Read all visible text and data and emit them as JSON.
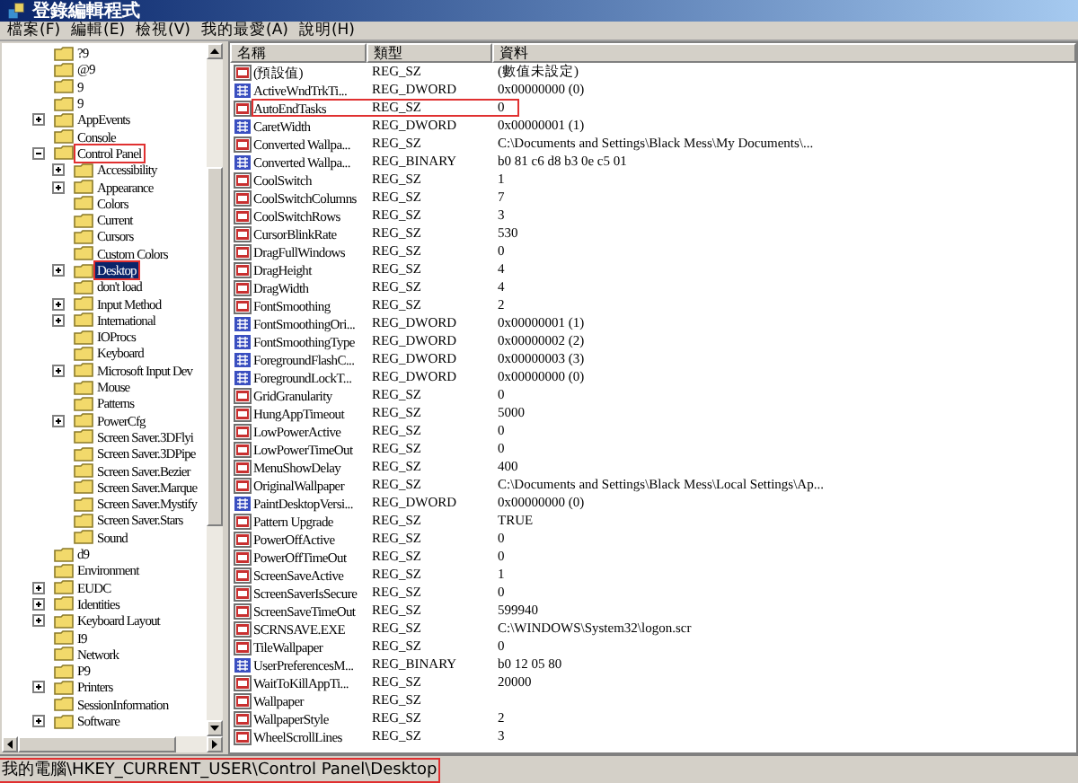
{
  "window": {
    "title": "登錄編輯程式"
  },
  "menu": [
    "檔案(F)",
    "編輯(E)",
    "檢視(V)",
    "我的最愛(A)",
    "說明(H)"
  ],
  "tree": [
    {
      "label": "?9",
      "kind": "leaf",
      "selected": false,
      "marked": false
    },
    {
      "label": "@9",
      "kind": "leaf",
      "selected": false,
      "marked": false
    },
    {
      "label": "9",
      "kind": "leaf",
      "selected": false,
      "marked": false
    },
    {
      "label": "9",
      "kind": "leaf",
      "selected": false,
      "marked": false
    },
    {
      "label": "AppEvents",
      "kind": "plus",
      "selected": false,
      "marked": false
    },
    {
      "label": "Console",
      "kind": "leaf",
      "selected": false,
      "marked": false
    },
    {
      "label": "Control Panel",
      "kind": "minus",
      "selected": false,
      "marked": true,
      "children": [
        {
          "label": "Accessibility",
          "kind": "plus",
          "selected": false,
          "marked": false
        },
        {
          "label": "Appearance",
          "kind": "plus",
          "selected": false,
          "marked": false
        },
        {
          "label": "Colors",
          "kind": "leaf",
          "selected": false,
          "marked": false
        },
        {
          "label": "Current",
          "kind": "leaf",
          "selected": false,
          "marked": false
        },
        {
          "label": "Cursors",
          "kind": "leaf",
          "selected": false,
          "marked": false
        },
        {
          "label": "Custom Colors",
          "kind": "leaf",
          "selected": false,
          "marked": false
        },
        {
          "label": "Desktop",
          "kind": "plus",
          "selected": true,
          "marked": true
        },
        {
          "label": "don't load",
          "kind": "leaf",
          "selected": false,
          "marked": false
        },
        {
          "label": "Input Method",
          "kind": "plus",
          "selected": false,
          "marked": false
        },
        {
          "label": "International",
          "kind": "plus",
          "selected": false,
          "marked": false
        },
        {
          "label": "IOProcs",
          "kind": "leaf",
          "selected": false,
          "marked": false
        },
        {
          "label": "Keyboard",
          "kind": "leaf",
          "selected": false,
          "marked": false
        },
        {
          "label": "Microsoft Input Dev",
          "kind": "plus",
          "selected": false,
          "marked": false
        },
        {
          "label": "Mouse",
          "kind": "leaf",
          "selected": false,
          "marked": false
        },
        {
          "label": "Patterns",
          "kind": "leaf",
          "selected": false,
          "marked": false
        },
        {
          "label": "PowerCfg",
          "kind": "plus",
          "selected": false,
          "marked": false
        },
        {
          "label": "Screen Saver.3DFlyi",
          "kind": "leaf",
          "selected": false,
          "marked": false
        },
        {
          "label": "Screen Saver.3DPipe",
          "kind": "leaf",
          "selected": false,
          "marked": false
        },
        {
          "label": "Screen Saver.Bezier",
          "kind": "leaf",
          "selected": false,
          "marked": false
        },
        {
          "label": "Screen Saver.Marque",
          "kind": "leaf",
          "selected": false,
          "marked": false
        },
        {
          "label": "Screen Saver.Mystify",
          "kind": "leaf",
          "selected": false,
          "marked": false
        },
        {
          "label": "Screen Saver.Stars",
          "kind": "leaf",
          "selected": false,
          "marked": false
        },
        {
          "label": "Sound",
          "kind": "leaf",
          "selected": false,
          "marked": false
        }
      ]
    },
    {
      "label": "d9",
      "kind": "leaf",
      "selected": false,
      "marked": false
    },
    {
      "label": "Environment",
      "kind": "leaf",
      "selected": false,
      "marked": false
    },
    {
      "label": "EUDC",
      "kind": "plus",
      "selected": false,
      "marked": false
    },
    {
      "label": "Identities",
      "kind": "plus",
      "selected": false,
      "marked": false
    },
    {
      "label": "Keyboard Layout",
      "kind": "plus",
      "selected": false,
      "marked": false
    },
    {
      "label": "I9",
      "kind": "leaf",
      "selected": false,
      "marked": false
    },
    {
      "label": "Network",
      "kind": "leaf",
      "selected": false,
      "marked": false
    },
    {
      "label": "P9",
      "kind": "leaf",
      "selected": false,
      "marked": false
    },
    {
      "label": "Printers",
      "kind": "plus",
      "selected": false,
      "marked": false
    },
    {
      "label": "SessionInformation",
      "kind": "leaf",
      "selected": false,
      "marked": false
    },
    {
      "label": "Software",
      "kind": "plus",
      "selected": false,
      "marked": false
    }
  ],
  "columns": [
    "名稱",
    "類型",
    "資料"
  ],
  "values": [
    {
      "name": "(預設值)",
      "type": "REG_SZ",
      "data": "(數值未設定)",
      "kind": "string",
      "marked": false
    },
    {
      "name": "ActiveWndTrkTi...",
      "type": "REG_DWORD",
      "data": "0x00000000 (0)",
      "kind": "binary",
      "marked": false
    },
    {
      "name": "AutoEndTasks",
      "type": "REG_SZ",
      "data": "0",
      "kind": "string",
      "marked": true
    },
    {
      "name": "CaretWidth",
      "type": "REG_DWORD",
      "data": "0x00000001 (1)",
      "kind": "binary",
      "marked": false
    },
    {
      "name": "Converted Wallpa...",
      "type": "REG_SZ",
      "data": "C:\\Documents and Settings\\Black Mess\\My Documents\\...",
      "kind": "string",
      "marked": false
    },
    {
      "name": "Converted Wallpa...",
      "type": "REG_BINARY",
      "data": "b0 81 c6 d8 b3 0e c5 01",
      "kind": "binary",
      "marked": false
    },
    {
      "name": "CoolSwitch",
      "type": "REG_SZ",
      "data": "1",
      "kind": "string",
      "marked": false
    },
    {
      "name": "CoolSwitchColumns",
      "type": "REG_SZ",
      "data": "7",
      "kind": "string",
      "marked": false
    },
    {
      "name": "CoolSwitchRows",
      "type": "REG_SZ",
      "data": "3",
      "kind": "string",
      "marked": false
    },
    {
      "name": "CursorBlinkRate",
      "type": "REG_SZ",
      "data": "530",
      "kind": "string",
      "marked": false
    },
    {
      "name": "DragFullWindows",
      "type": "REG_SZ",
      "data": "0",
      "kind": "string",
      "marked": false
    },
    {
      "name": "DragHeight",
      "type": "REG_SZ",
      "data": "4",
      "kind": "string",
      "marked": false
    },
    {
      "name": "DragWidth",
      "type": "REG_SZ",
      "data": "4",
      "kind": "string",
      "marked": false
    },
    {
      "name": "FontSmoothing",
      "type": "REG_SZ",
      "data": "2",
      "kind": "string",
      "marked": false
    },
    {
      "name": "FontSmoothingOri...",
      "type": "REG_DWORD",
      "data": "0x00000001 (1)",
      "kind": "binary",
      "marked": false
    },
    {
      "name": "FontSmoothingType",
      "type": "REG_DWORD",
      "data": "0x00000002 (2)",
      "kind": "binary",
      "marked": false
    },
    {
      "name": "ForegroundFlashC...",
      "type": "REG_DWORD",
      "data": "0x00000003 (3)",
      "kind": "binary",
      "marked": false
    },
    {
      "name": "ForegroundLockT...",
      "type": "REG_DWORD",
      "data": "0x00000000 (0)",
      "kind": "binary",
      "marked": false
    },
    {
      "name": "GridGranularity",
      "type": "REG_SZ",
      "data": "0",
      "kind": "string",
      "marked": false
    },
    {
      "name": "HungAppTimeout",
      "type": "REG_SZ",
      "data": "5000",
      "kind": "string",
      "marked": false
    },
    {
      "name": "LowPowerActive",
      "type": "REG_SZ",
      "data": "0",
      "kind": "string",
      "marked": false
    },
    {
      "name": "LowPowerTimeOut",
      "type": "REG_SZ",
      "data": "0",
      "kind": "string",
      "marked": false
    },
    {
      "name": "MenuShowDelay",
      "type": "REG_SZ",
      "data": "400",
      "kind": "string",
      "marked": false
    },
    {
      "name": "OriginalWallpaper",
      "type": "REG_SZ",
      "data": "C:\\Documents and Settings\\Black Mess\\Local Settings\\Ap...",
      "kind": "string",
      "marked": false
    },
    {
      "name": "PaintDesktopVersi...",
      "type": "REG_DWORD",
      "data": "0x00000000 (0)",
      "kind": "binary",
      "marked": false
    },
    {
      "name": "Pattern Upgrade",
      "type": "REG_SZ",
      "data": "TRUE",
      "kind": "string",
      "marked": false
    },
    {
      "name": "PowerOffActive",
      "type": "REG_SZ",
      "data": "0",
      "kind": "string",
      "marked": false
    },
    {
      "name": "PowerOffTimeOut",
      "type": "REG_SZ",
      "data": "0",
      "kind": "string",
      "marked": false
    },
    {
      "name": "ScreenSaveActive",
      "type": "REG_SZ",
      "data": "1",
      "kind": "string",
      "marked": false
    },
    {
      "name": "ScreenSaverIsSecure",
      "type": "REG_SZ",
      "data": "0",
      "kind": "string",
      "marked": false
    },
    {
      "name": "ScreenSaveTimeOut",
      "type": "REG_SZ",
      "data": "599940",
      "kind": "string",
      "marked": false
    },
    {
      "name": "SCRNSAVE.EXE",
      "type": "REG_SZ",
      "data": "C:\\WINDOWS\\System32\\logon.scr",
      "kind": "string",
      "marked": false
    },
    {
      "name": "TileWallpaper",
      "type": "REG_SZ",
      "data": "0",
      "kind": "string",
      "marked": false
    },
    {
      "name": "UserPreferencesM...",
      "type": "REG_BINARY",
      "data": "b0 12 05 80",
      "kind": "binary",
      "marked": false
    },
    {
      "name": "WaitToKillAppTi...",
      "type": "REG_SZ",
      "data": "20000",
      "kind": "string",
      "marked": false
    },
    {
      "name": "Wallpaper",
      "type": "REG_SZ",
      "kind": "string",
      "marked": false
    },
    {
      "name": "WallpaperStyle",
      "type": "REG_SZ",
      "data": "2",
      "kind": "string",
      "marked": false
    },
    {
      "name": "WheelScrollLines",
      "type": "REG_SZ",
      "data": "3",
      "kind": "string",
      "marked": false
    }
  ],
  "status_bar": {
    "text": "我的電腦\\HKEY_CURRENT_USER\\Control Panel\\Desktop",
    "marked": true
  }
}
